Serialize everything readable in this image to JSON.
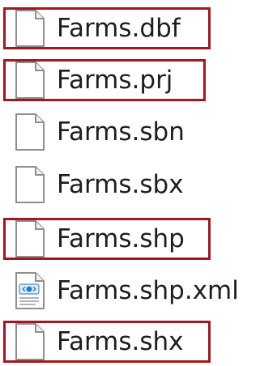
{
  "accent_color": "#a5171c",
  "files": [
    {
      "name": "Farms.dbf",
      "icon": "blank-file-icon",
      "highlighted": true
    },
    {
      "name": "Farms.prj",
      "icon": "blank-file-icon",
      "highlighted": true
    },
    {
      "name": "Farms.sbn",
      "icon": "blank-file-icon",
      "highlighted": false
    },
    {
      "name": "Farms.sbx",
      "icon": "blank-file-icon",
      "highlighted": false
    },
    {
      "name": "Farms.shp",
      "icon": "blank-file-icon",
      "highlighted": true
    },
    {
      "name": "Farms.shp.xml",
      "icon": "xml-file-icon",
      "highlighted": false
    },
    {
      "name": "Farms.shx",
      "icon": "blank-file-icon",
      "highlighted": true
    }
  ]
}
